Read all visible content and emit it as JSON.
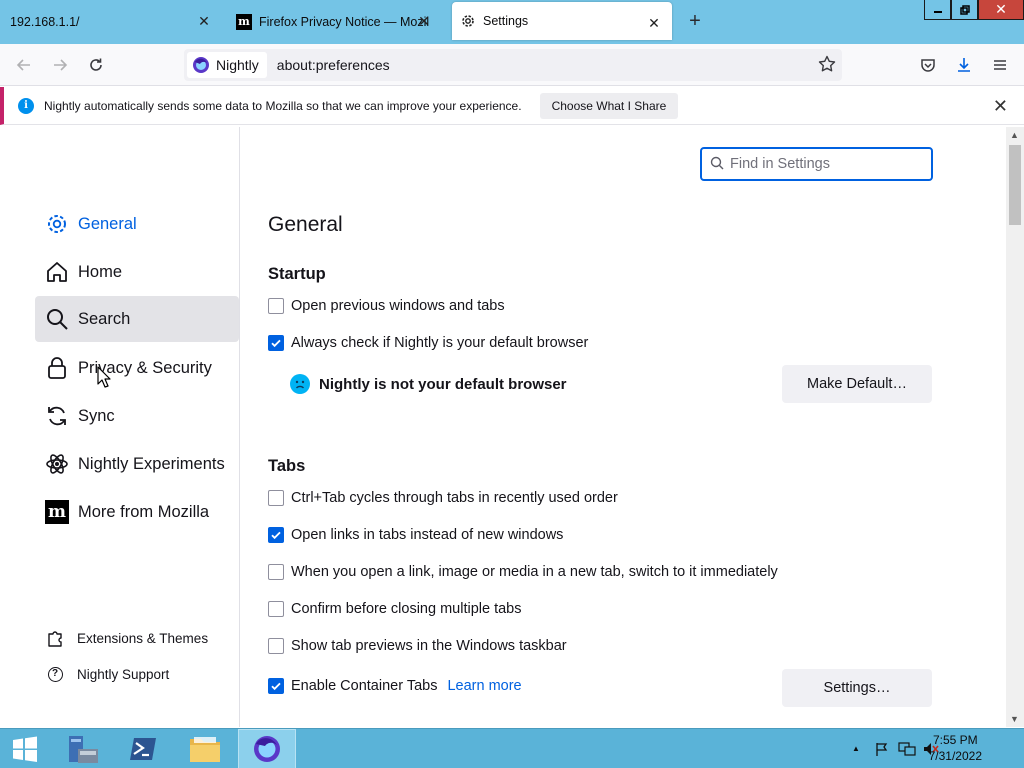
{
  "tabs": [
    {
      "title": "192.168.1.1/",
      "close": "✕"
    },
    {
      "title": "Firefox Privacy Notice — Mozilla",
      "close": "✕",
      "icon": "mozilla-m-icon",
      "icon_text": "m"
    },
    {
      "title": "Settings",
      "close": "✕",
      "icon": "gear-icon"
    }
  ],
  "new_tab": "+",
  "window_controls": {
    "close": "✕"
  },
  "navbar": {
    "identity_label": "Nightly",
    "url": "about:preferences"
  },
  "notice": {
    "info": "i",
    "message": "Nightly automatically sends some data to Mozilla so that we can improve your experience.",
    "button": "Choose What I Share",
    "close": "✕"
  },
  "sidebar": {
    "categories": [
      {
        "label": "General",
        "icon": "gear-icon",
        "selected": true
      },
      {
        "label": "Home",
        "icon": "home-icon"
      },
      {
        "label": "Search",
        "icon": "search-icon",
        "hover": true
      },
      {
        "label": "Privacy & Security",
        "icon": "lock-icon"
      },
      {
        "label": "Sync",
        "icon": "sync-icon"
      },
      {
        "label": "Nightly Experiments",
        "icon": "experiments-icon"
      },
      {
        "label": "More from Mozilla",
        "icon": "mozilla-m-icon",
        "icon_text": "m"
      }
    ],
    "footer": [
      {
        "label": "Extensions & Themes",
        "icon": "puzzle-icon"
      },
      {
        "label": "Nightly Support",
        "icon": "help-icon",
        "icon_text": "?"
      }
    ]
  },
  "main": {
    "search_placeholder": "Find in Settings",
    "title": "General",
    "startup": {
      "heading": "Startup",
      "open_previous": {
        "label": "Open previous windows and tabs",
        "checked": false
      },
      "always_check": {
        "label": "Always check if Nightly is your default browser",
        "checked": true
      },
      "not_default": "Nightly is not your default browser",
      "make_default": "Make Default…"
    },
    "tabs_section": {
      "heading": "Tabs",
      "options": [
        {
          "label": "Ctrl+Tab cycles through tabs in recently used order",
          "checked": false
        },
        {
          "label": "Open links in tabs instead of new windows",
          "checked": true
        },
        {
          "label": "When you open a link, image or media in a new tab, switch to it immediately",
          "checked": false
        },
        {
          "label": "Confirm before closing multiple tabs",
          "checked": false
        },
        {
          "label": "Show tab previews in the Windows taskbar",
          "checked": false
        },
        {
          "label": "Enable Container Tabs",
          "checked": true
        }
      ],
      "learn_more": "Learn more",
      "settings_button": "Settings…"
    }
  },
  "taskbar": {
    "items": [
      "windows-start-icon",
      "server-manager-icon",
      "powershell-icon",
      "file-explorer-icon",
      "firefox-nightly-icon"
    ],
    "clock_time": "7:55 PM",
    "clock_date": "7/31/2022",
    "tray_arrow": "▲"
  },
  "colors": {
    "accent": "#0061e0",
    "tabbar": "#74c4e6",
    "taskbar": "#5ab3d8",
    "notice_border": "#c42269"
  }
}
